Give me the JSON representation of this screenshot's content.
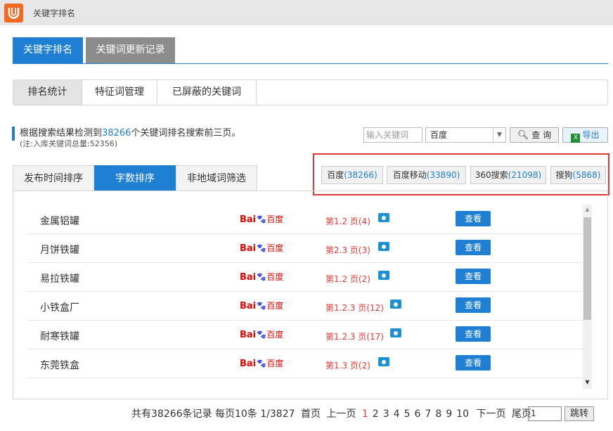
{
  "app": {
    "title": "关键字排名"
  },
  "main_tabs": [
    {
      "label": "关键字排名",
      "active": true
    },
    {
      "label": "关键词更新记录",
      "active": false
    }
  ],
  "sub_tabs": [
    {
      "label": "排名统计",
      "active": true
    },
    {
      "label": "特征词管理",
      "active": false
    },
    {
      "label": "已屏蔽的关键词",
      "active": false
    }
  ],
  "info": {
    "line1_prefix": "根据搜索结果检测到",
    "count": "38266",
    "line1_suffix": "个关键词排名搜索前三页。",
    "line2": "(注:入库关键词总量:52356)"
  },
  "search": {
    "placeholder": "输入关键词",
    "engine": "百度",
    "query_label": "查 询",
    "export_label": "导出"
  },
  "sort_tabs": [
    {
      "label": "发布时间排序",
      "active": false
    },
    {
      "label": "字数排序",
      "active": true
    },
    {
      "label": "非地域词筛选",
      "active": false
    }
  ],
  "engines": [
    {
      "name": "百度",
      "count": "(38266)"
    },
    {
      "name": "百度移动",
      "count": "(33890)"
    },
    {
      "name": "360搜索",
      "count": "(21098)"
    },
    {
      "name": "搜狗",
      "count": "(5868)"
    }
  ],
  "rows": [
    {
      "keyword": "金属铝罐",
      "rank": "第1.2 页(4)",
      "view": "查看"
    },
    {
      "keyword": "月饼铁罐",
      "rank": "第2.3 页(3)",
      "view": "查看"
    },
    {
      "keyword": "易拉铁罐",
      "rank": "第1.2 页(2)",
      "view": "查看"
    },
    {
      "keyword": "小铁盒厂",
      "rank": "第1.2.3 页(12)",
      "view": "查看"
    },
    {
      "keyword": "耐寒铁罐",
      "rank": "第1.2.3 页(17)",
      "view": "查看"
    },
    {
      "keyword": "东莞铁盒",
      "rank": "第1.3 页(2)",
      "view": "查看"
    }
  ],
  "baidu_logo": {
    "bai": "Bai",
    "du": "百度"
  },
  "pagination": {
    "summary": "共有38266条记录 每页10条 1/3827",
    "first": "首页",
    "prev": "上一页",
    "pages": [
      "1",
      "2",
      "3",
      "4",
      "5",
      "6",
      "7",
      "8",
      "9",
      "10"
    ],
    "current": "1",
    "next": "下一页",
    "last": "尾页",
    "input_value": "1",
    "jump": "跳转"
  },
  "colors": {
    "accent": "#1e7fd3",
    "rank_red": "#e53935",
    "highlight": "#e53935",
    "logo": "#f26a21"
  }
}
